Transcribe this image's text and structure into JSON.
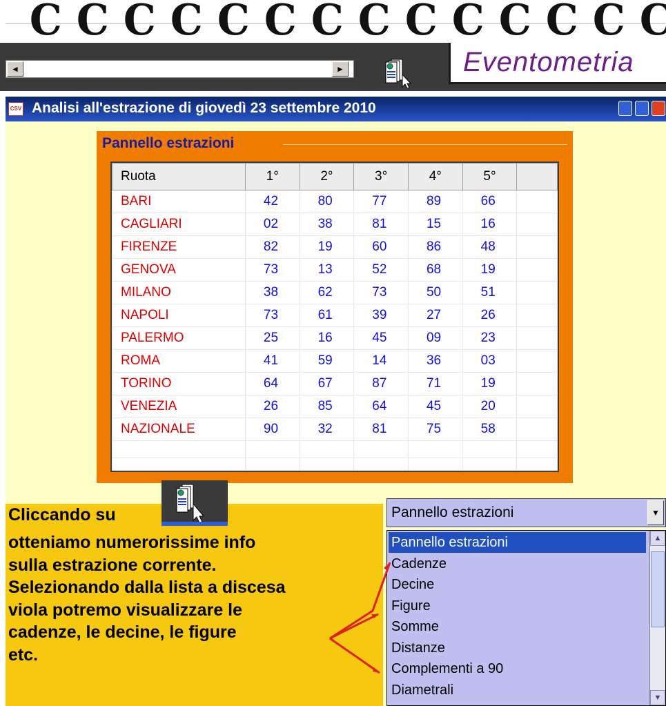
{
  "toolbar": {
    "app_title": "Eventometria",
    "scroll_left": "◄",
    "scroll_right": "►"
  },
  "window": {
    "title": "Analisi all'estrazione di giovedì 23 settembre 2010"
  },
  "panel": {
    "title": "Pannello estrazioni",
    "headers": [
      "Ruota",
      "1°",
      "2°",
      "3°",
      "4°",
      "5°"
    ],
    "rows": [
      {
        "ruota": "BARI",
        "numbers": [
          "42",
          "80",
          "77",
          "89",
          "66"
        ]
      },
      {
        "ruota": "CAGLIARI",
        "numbers": [
          "02",
          "38",
          "81",
          "15",
          "16"
        ]
      },
      {
        "ruota": "FIRENZE",
        "numbers": [
          "82",
          "19",
          "60",
          "86",
          "48"
        ]
      },
      {
        "ruota": "GENOVA",
        "numbers": [
          "73",
          "13",
          "52",
          "68",
          "19"
        ]
      },
      {
        "ruota": "MILANO",
        "numbers": [
          "38",
          "62",
          "73",
          "50",
          "51"
        ]
      },
      {
        "ruota": "NAPOLI",
        "numbers": [
          "73",
          "61",
          "39",
          "27",
          "26"
        ]
      },
      {
        "ruota": "PALERMO",
        "numbers": [
          "25",
          "16",
          "45",
          "09",
          "23"
        ]
      },
      {
        "ruota": "ROMA",
        "numbers": [
          "41",
          "59",
          "14",
          "36",
          "03"
        ]
      },
      {
        "ruota": "TORINO",
        "numbers": [
          "64",
          "67",
          "87",
          "71",
          "19"
        ]
      },
      {
        "ruota": "VENEZIA",
        "numbers": [
          "26",
          "85",
          "64",
          "45",
          "20"
        ]
      },
      {
        "ruota": "NAZIONALE",
        "numbers": [
          "90",
          "32",
          "81",
          "75",
          "58"
        ]
      }
    ]
  },
  "note": {
    "first_line": "Cliccando su",
    "lines": [
      "otteniamo numerorissime info",
      "sulla estrazione corrente.",
      "Selezionando dalla lista a discesa",
      "viola potremo visualizzare le",
      "cadenze, le decine, le figure",
      "etc."
    ]
  },
  "combo": {
    "value": "Pannello estrazioni",
    "options": [
      "Pannello estrazioni",
      "Cadenze",
      "Decine",
      "Figure",
      "Somme",
      "Distanze",
      "Complementi a 90",
      "Diametrali"
    ],
    "selected_index": 0
  },
  "colors": {
    "panel_orange": "#f07c00",
    "city_red": "#e00000",
    "number_blue": "#1010e0",
    "note_yellow": "#f6c810",
    "combo_violet": "#c0c0f0",
    "arrow_red": "#e02020"
  },
  "icons": [
    "document-globe-icon",
    "cursor-arrow-icon",
    "app-window-icon",
    "minimize-icon",
    "maximize-icon",
    "close-icon"
  ]
}
